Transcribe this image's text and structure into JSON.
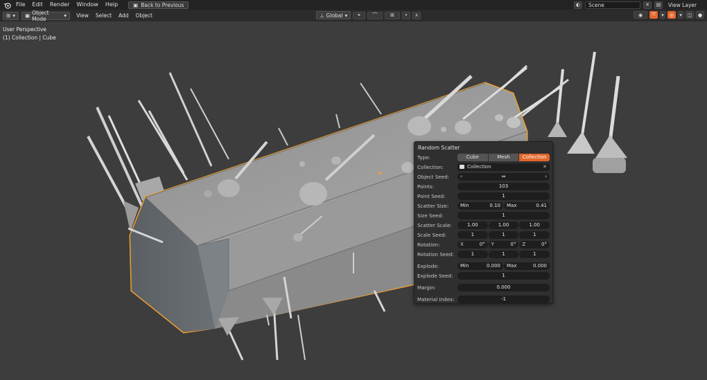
{
  "menubar": {
    "items": [
      "File",
      "Edit",
      "Render",
      "Window",
      "Help"
    ],
    "back_button": "Back to Previous",
    "scene_label": "Scene",
    "view_layer_label": "View Layer"
  },
  "header": {
    "mode": "Object Mode",
    "menus": [
      "View",
      "Select",
      "Add",
      "Object"
    ],
    "orientation": "Global"
  },
  "viewport": {
    "perspective": "User Perspective",
    "collection_info": "(1) Collection | Cube"
  },
  "panel": {
    "title": "Random Scatter",
    "type_label": "Type:",
    "type_options": [
      "Cube",
      "Mesh",
      "Collection"
    ],
    "type_selected": "Collection",
    "collection_label": "Collection:",
    "collection_value": "Collection",
    "object_seed_label": "Object Seed:",
    "points_label": "Points:",
    "points_value": "103",
    "point_seed_label": "Point Seed:",
    "point_seed_value": "1",
    "scatter_size_label": "Scatter Size:",
    "min_label": "Min",
    "max_label": "Max",
    "scatter_size_min": "0.10",
    "scatter_size_max": "0.41",
    "size_seed_label": "Size Seed:",
    "size_seed_value": "1",
    "scatter_scale_label": "Scatter Scale:",
    "scatter_scale_values": [
      "1.00",
      "1.00",
      "1.00"
    ],
    "scale_seed_label": "Scale Seed:",
    "scale_seed_values": [
      "1",
      "1",
      "1"
    ],
    "rotation_label": "Rotation:",
    "rotation_axes": [
      "X",
      "Y",
      "Z"
    ],
    "rotation_values": [
      "0°",
      "0°",
      "0°"
    ],
    "rotation_seed_label": "Rotation Seed:",
    "rotation_seed_values": [
      "1",
      "1",
      "1"
    ],
    "explode_label": "Explode:",
    "explode_min": "0.000",
    "explode_max": "0.000",
    "explode_seed_label": "Explode Seed:",
    "explode_seed_value": "1",
    "margin_label": "Margin:",
    "margin_value": "0.000",
    "material_index_label": "Material Index:",
    "material_index_value": "-1"
  },
  "colors": {
    "accent": "#e2662a",
    "selection_outline": "#f0a030",
    "viewport_bg": "#3d3d3d"
  }
}
